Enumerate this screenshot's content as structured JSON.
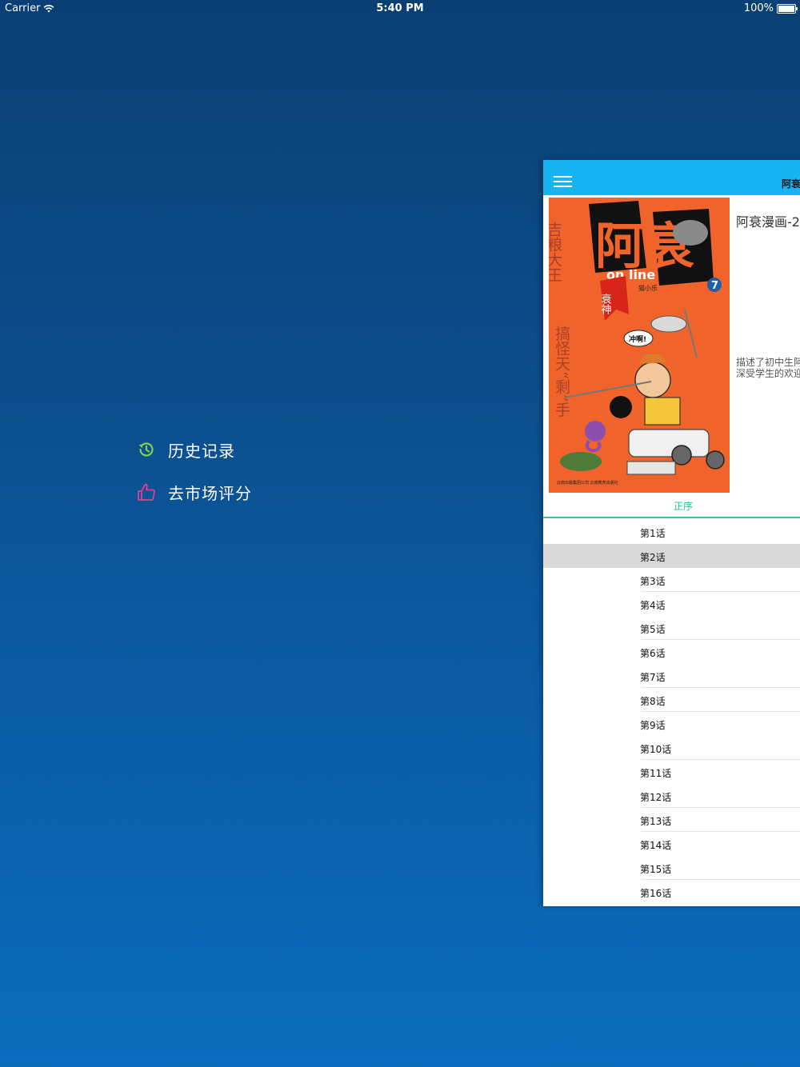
{
  "status_bar": {
    "carrier": "Carrier",
    "time": "5:40 PM",
    "battery": "100%"
  },
  "side_menu": {
    "items": [
      {
        "label": "历史记录",
        "icon": "history-icon",
        "color": "#7fd14a"
      },
      {
        "label": "去市场评分",
        "icon": "thumbs-up-icon",
        "color": "#e8478f"
      }
    ]
  },
  "panel": {
    "nav_title": "阿衰",
    "comic_title": "阿衰漫画-2",
    "description_lines": [
      "描述了初中生阿",
      "深受学生的欢迎"
    ],
    "sort_label": "正序",
    "accent_color": "#16b5f2",
    "tab_color": "#2fcf9c",
    "chapters": [
      "第1话",
      "第2话",
      "第3话",
      "第4话",
      "第5话",
      "第6话",
      "第7话",
      "第8话",
      "第9话",
      "第10话",
      "第11话",
      "第12话",
      "第13话",
      "第14话",
      "第15话",
      "第16话"
    ],
    "selected_chapter": "第2话"
  },
  "cover": {
    "title_text": "阿衰",
    "online_text": "on line",
    "volume": "7",
    "author": "猫小乐",
    "banner_text": "衰神",
    "bubble_text": "冲啊!",
    "side_text_left": "吉粮大王",
    "side_text_right": "搞怪天“剩”手",
    "publisher": "云南出版集团公司 云南教育出版社"
  }
}
